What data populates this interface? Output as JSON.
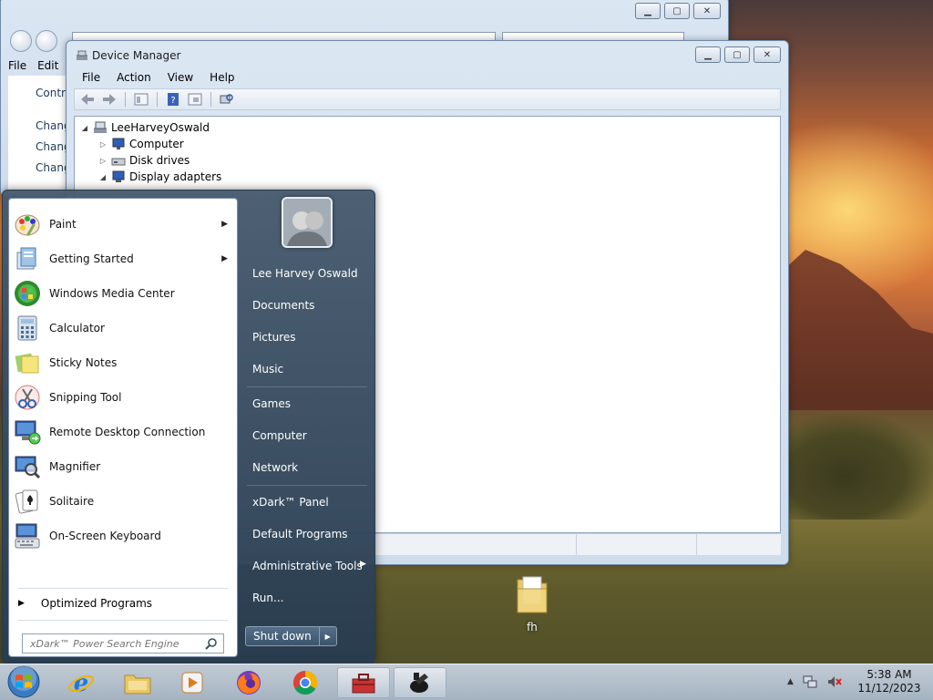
{
  "control_panel": {
    "menu": [
      "File",
      "Edit"
    ],
    "links": [
      "Contro",
      "Chang",
      "Chang",
      "Chang"
    ]
  },
  "device_manager": {
    "title": "Device Manager",
    "menu": [
      "File",
      "Action",
      "View",
      "Help"
    ],
    "tree": [
      {
        "label": "LeeHarveyOswald"
      },
      {
        "label": "Computer"
      },
      {
        "label": "Disk drives"
      },
      {
        "label": "Display adapters"
      }
    ]
  },
  "start_menu": {
    "programs": [
      {
        "label": "Paint",
        "has_submenu": true,
        "icon": "paint-icon"
      },
      {
        "label": "Getting Started",
        "has_submenu": true,
        "icon": "getting-started-icon"
      },
      {
        "label": "Windows Media Center",
        "has_submenu": false,
        "icon": "media-center-icon"
      },
      {
        "label": "Calculator",
        "has_submenu": false,
        "icon": "calculator-icon"
      },
      {
        "label": "Sticky Notes",
        "has_submenu": false,
        "icon": "sticky-notes-icon"
      },
      {
        "label": "Snipping Tool",
        "has_submenu": false,
        "icon": "snipping-tool-icon"
      },
      {
        "label": "Remote Desktop Connection",
        "has_submenu": false,
        "icon": "remote-desktop-icon"
      },
      {
        "label": "Magnifier",
        "has_submenu": false,
        "icon": "magnifier-icon"
      },
      {
        "label": "Solitaire",
        "has_submenu": false,
        "icon": "solitaire-icon"
      },
      {
        "label": "On-Screen Keyboard",
        "has_submenu": false,
        "icon": "keyboard-icon"
      }
    ],
    "optimized_programs": "Optimized Programs",
    "search_placeholder": "xDark™ Power Search Engine",
    "right_links": [
      "Lee Harvey Oswald",
      "Documents",
      "Pictures",
      "Music",
      "Games",
      "Computer",
      "Network",
      "xDark™ Panel",
      "Default Programs",
      "Administrative Tools",
      "Run..."
    ],
    "shutdown_label": "Shut down"
  },
  "desktop": {
    "icon_label": "fh"
  },
  "taskbar": {
    "time": "5:38 AM",
    "date": "11/12/2023"
  },
  "colors": {
    "start_menu_bg": "#3f5670",
    "taskbar_bg": "#b8c6d6",
    "window_frame": "#cfdcec"
  }
}
